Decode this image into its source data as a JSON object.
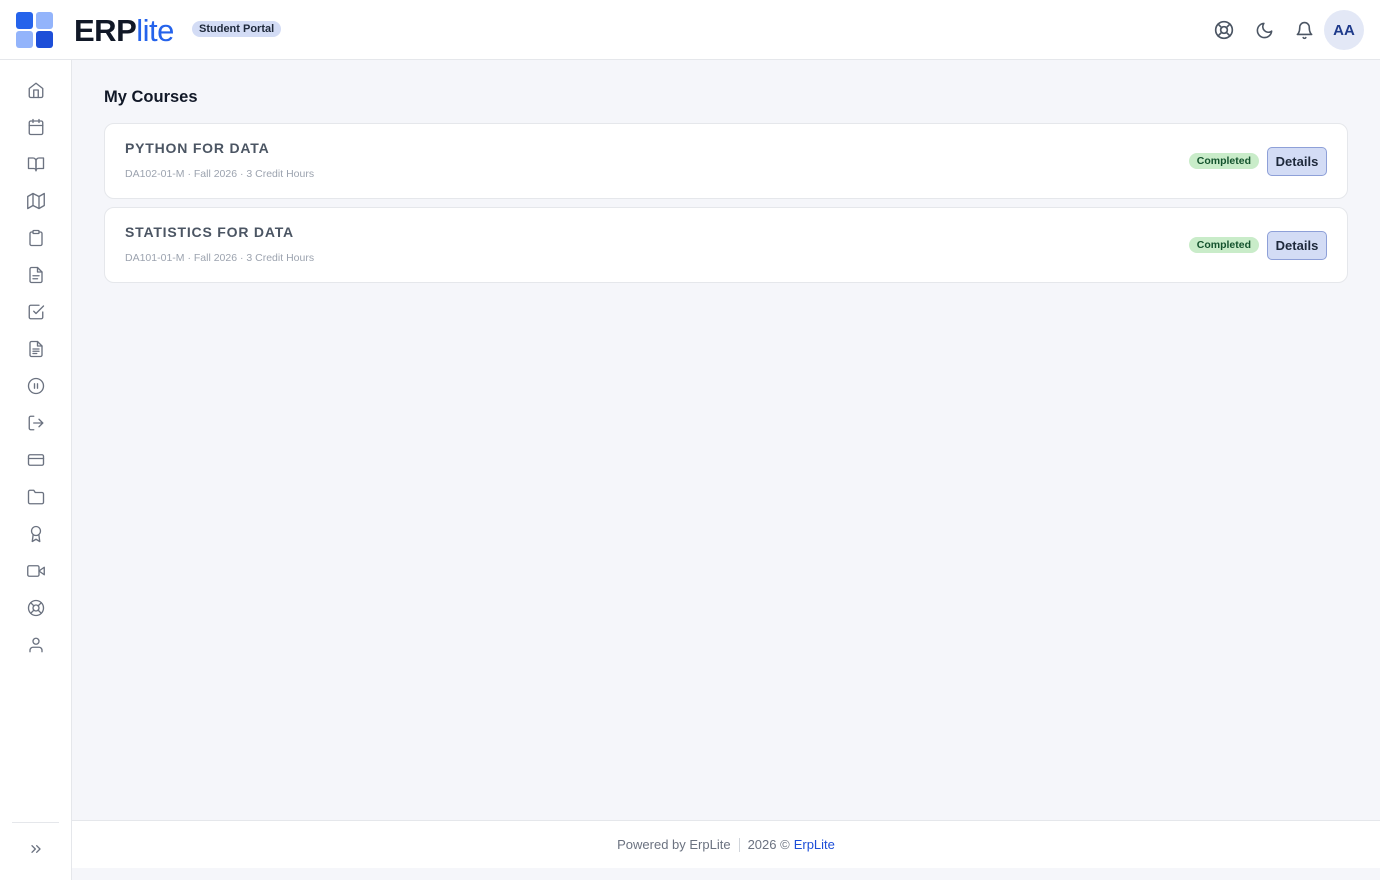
{
  "header": {
    "brand_bold": "ERP",
    "brand_light": "lite",
    "portal_badge": "Student Portal",
    "avatar_initials": "AA",
    "icons": [
      "help-circle-icon",
      "moon-icon",
      "bell-icon"
    ]
  },
  "sidebar": {
    "items": [
      {
        "icon": "home-icon"
      },
      {
        "icon": "calendar-icon"
      },
      {
        "icon": "book-open-icon"
      },
      {
        "icon": "map-icon"
      },
      {
        "icon": "clipboard-icon"
      },
      {
        "icon": "file-text-icon"
      },
      {
        "icon": "check-square-icon"
      },
      {
        "icon": "document-icon"
      },
      {
        "icon": "pause-circle-icon"
      },
      {
        "icon": "log-out-icon"
      },
      {
        "icon": "credit-card-icon"
      },
      {
        "icon": "folder-icon"
      },
      {
        "icon": "award-icon"
      },
      {
        "icon": "video-icon"
      },
      {
        "icon": "lifebuoy-icon"
      },
      {
        "icon": "user-icon"
      }
    ],
    "collapse_icon": "chevrons-right-icon"
  },
  "main": {
    "title": "My Courses",
    "courses": [
      {
        "name": "PYTHON FOR DATA",
        "meta": "DA102-01-M · Fall 2026 · 3 Credit Hours",
        "status": "Completed",
        "action": "Details"
      },
      {
        "name": "STATISTICS FOR DATA",
        "meta": "DA101-01-M · Fall 2026 · 3 Credit Hours",
        "status": "Completed",
        "action": "Details"
      }
    ]
  },
  "footer": {
    "powered_by": "Powered by ErpLite",
    "copyright": "2026 ©",
    "link": "ErpLite"
  },
  "colors": {
    "accent": "#2563eb",
    "status_completed_bg": "#c9ecc9",
    "status_completed_text": "#14532d",
    "button_bg": "#d3dcf5"
  }
}
